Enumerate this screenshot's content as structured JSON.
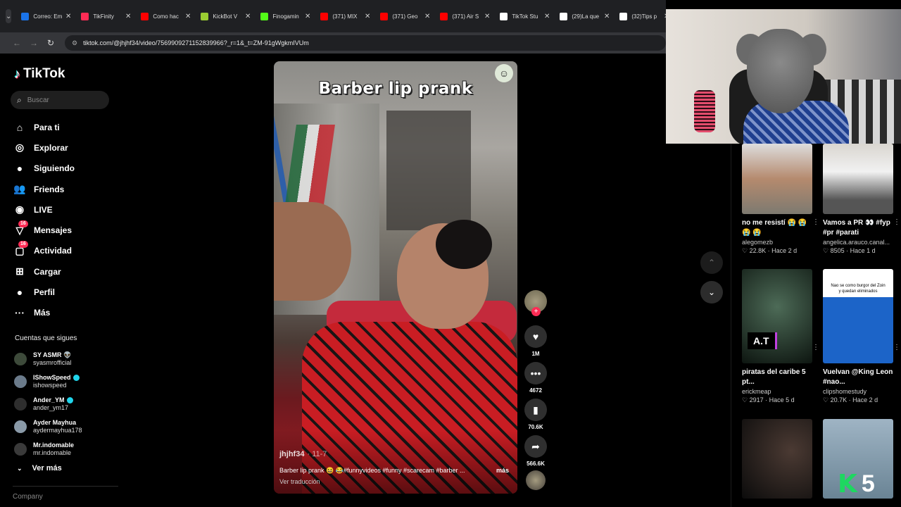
{
  "tabs": [
    {
      "title": "Correo: Em",
      "color": "#1a73e8"
    },
    {
      "title": "TikFinity",
      "color": "#fe2c55"
    },
    {
      "title": "Como hac",
      "color": "#ff0000"
    },
    {
      "title": "KickBot V",
      "color": "#9acd32"
    },
    {
      "title": "Finogamin",
      "color": "#53fc18"
    },
    {
      "title": "(371) MIX",
      "color": "#ff0000"
    },
    {
      "title": "(371) Geo",
      "color": "#ff0000"
    },
    {
      "title": "(371) Air S",
      "color": "#ff0000"
    },
    {
      "title": "TikTok Stu",
      "color": "#ffffff"
    },
    {
      "title": "(29)La que",
      "color": "#ffffff"
    },
    {
      "title": "(32)Tips p",
      "color": "#ffffff"
    }
  ],
  "address": {
    "url": "tiktok.com/@jhjhf34/video/7569909271152839966?_r=1&_t=ZM-91gWgkmIVUm"
  },
  "sidebar": {
    "logo": "TikTok",
    "search_placeholder": "Buscar",
    "menu": [
      {
        "label": "Para ti",
        "icon": "home-icon"
      },
      {
        "label": "Explorar",
        "icon": "compass-icon"
      },
      {
        "label": "Siguiendo",
        "icon": "following-avatar-icon"
      },
      {
        "label": "Friends",
        "icon": "friends-icon"
      },
      {
        "label": "LIVE",
        "icon": "live-icon"
      },
      {
        "label": "Mensajes",
        "icon": "messages-icon",
        "badge": "16"
      },
      {
        "label": "Actividad",
        "icon": "activity-icon",
        "badge": "16"
      },
      {
        "label": "Cargar",
        "icon": "upload-icon"
      },
      {
        "label": "Perfil",
        "icon": "profile-icon"
      },
      {
        "label": "Más",
        "icon": "more-icon"
      }
    ],
    "following_heading": "Cuentas que sigues",
    "following": [
      {
        "name": "SY ASMR 👽",
        "handle": "syasmrofficial",
        "verified": false
      },
      {
        "name": "IShowSpeed",
        "handle": "ishowspeed",
        "verified": true
      },
      {
        "name": "Ander_YM",
        "handle": "ander_ym17",
        "verified": true
      },
      {
        "name": "Ayder Mayhua",
        "handle": "aydermayhua178",
        "verified": false
      },
      {
        "name": "Mr.indomable",
        "handle": "mr.indomable",
        "verified": false
      }
    ],
    "see_more": "Ver más",
    "company": "Company"
  },
  "video": {
    "overlay_title": "Barber lip prank",
    "author": "jhjhf34",
    "date": "11-7",
    "caption": "Barber lip prank 😆 😂#funnyvideos #funny #scarecam #barber ...",
    "more": "más",
    "translate": "Ver traducción"
  },
  "actions": {
    "likes": "1M",
    "comments": "4672",
    "saves": "70.6K",
    "shares": "566.6K"
  },
  "recommendations": [
    {
      "title": "no me resistí 😭 😭 😭 😭",
      "author": "alegomezb",
      "likes": "22.8K",
      "age": "Hace 2 d"
    },
    {
      "title": "Vamos a PR 👀 #fyp #pr #parati",
      "author": "angelica.arauco.canal...",
      "likes": "8505",
      "age": "Hace 1 d"
    },
    {
      "title": "piratas del caribe 5 pt...",
      "author": "erickmeap",
      "likes": "2917",
      "age": "Hace 5 d",
      "thumb_text": "A.T"
    },
    {
      "title": "Vuelvan @King Leon #nao...",
      "author": "clipshomestudy",
      "likes": "20.7K",
      "age": "Hace 2 d",
      "thumb_text": "Nao se como burgor del Zoin y quedan eliminados"
    },
    {
      "title": "",
      "author": "",
      "likes": "",
      "age": ""
    },
    {
      "title": "",
      "author": "",
      "likes": "",
      "age": ""
    }
  ],
  "overlay_badge": "5",
  "colors": {
    "accent": "#fe2c55",
    "kick_green": "#1ed760",
    "background": "#000000"
  }
}
